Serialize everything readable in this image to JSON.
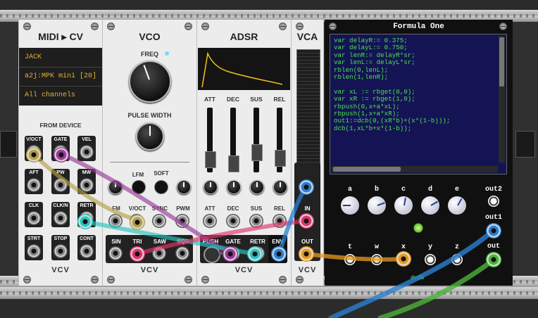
{
  "midi_cv": {
    "title": "MIDI ▸ CV",
    "driver": "JACK",
    "device": "a2j:MPK mini [20]",
    "channel": "All channels",
    "from_device": "FROM DEVICE",
    "outputs": [
      "V/OCT",
      "GATE",
      "VEL",
      "AFT",
      "PW",
      "MW",
      "CLK",
      "CLK/N",
      "RETR",
      "STRT",
      "STOP",
      "CONT"
    ],
    "brand": "VCV"
  },
  "vco": {
    "title": "VCO",
    "freq": "FREQ",
    "pulse_width": "PULSE WIDTH",
    "lfm": "LFM",
    "soft": "SOFT",
    "inputs": [
      "FM",
      "V/OCT",
      "SYNC",
      "PWM"
    ],
    "outputs": [
      "SIN",
      "TRI",
      "SAW",
      "SQR"
    ],
    "brand": "VCV"
  },
  "adsr": {
    "title": "ADSR",
    "sliders": [
      "ATT",
      "DEC",
      "SUS",
      "REL"
    ],
    "cv": [
      "ATT",
      "DEC",
      "SUS",
      "REL"
    ],
    "push": "PUSH",
    "gate": "GATE",
    "retr": "RETR",
    "env": "ENV",
    "brand": "VCV"
  },
  "vca": {
    "title": "VCA",
    "in": "IN",
    "out": "OUT",
    "brand": "VCV"
  },
  "formula": {
    "title": "Formula One",
    "code": [
      "var delayR:= 0.375;",
      "var delayL:= 0.750;",
      "var lenR:= delayR*sr;",
      "var lenL:= delayL*sr;",
      "rblen(0,lenL);",
      "rblen(1,lenR);",
      "",
      "var xL := rbget(0,0);",
      "var xR := rbget(1,0);",
      "rbpush(0,x+a*xL);",
      "rbpush(1,x+a*xR);",
      "out1:=dcb(0,(xR*b)+(x*(1-b)));",
      "dcb(1,xL*b+x*(1-b));"
    ],
    "knobs": [
      "a",
      "b",
      "c",
      "d",
      "e"
    ],
    "inputs": [
      "t",
      "w",
      "x",
      "y",
      "z"
    ],
    "outputs": [
      "out2",
      "out1",
      "out"
    ],
    "brand": "dcdb"
  },
  "colors": {
    "cable_yellow": "#b5a04a",
    "cable_purple": "#9a3b9a",
    "cable_teal": "#2bc4c0",
    "cable_pink": "#e0356a",
    "cable_blue": "#2a7fd0",
    "cable_orange": "#e89a1e",
    "cable_green": "#4cb23a",
    "editor_text": "#4fe04f",
    "editor_bg": "#141455"
  }
}
